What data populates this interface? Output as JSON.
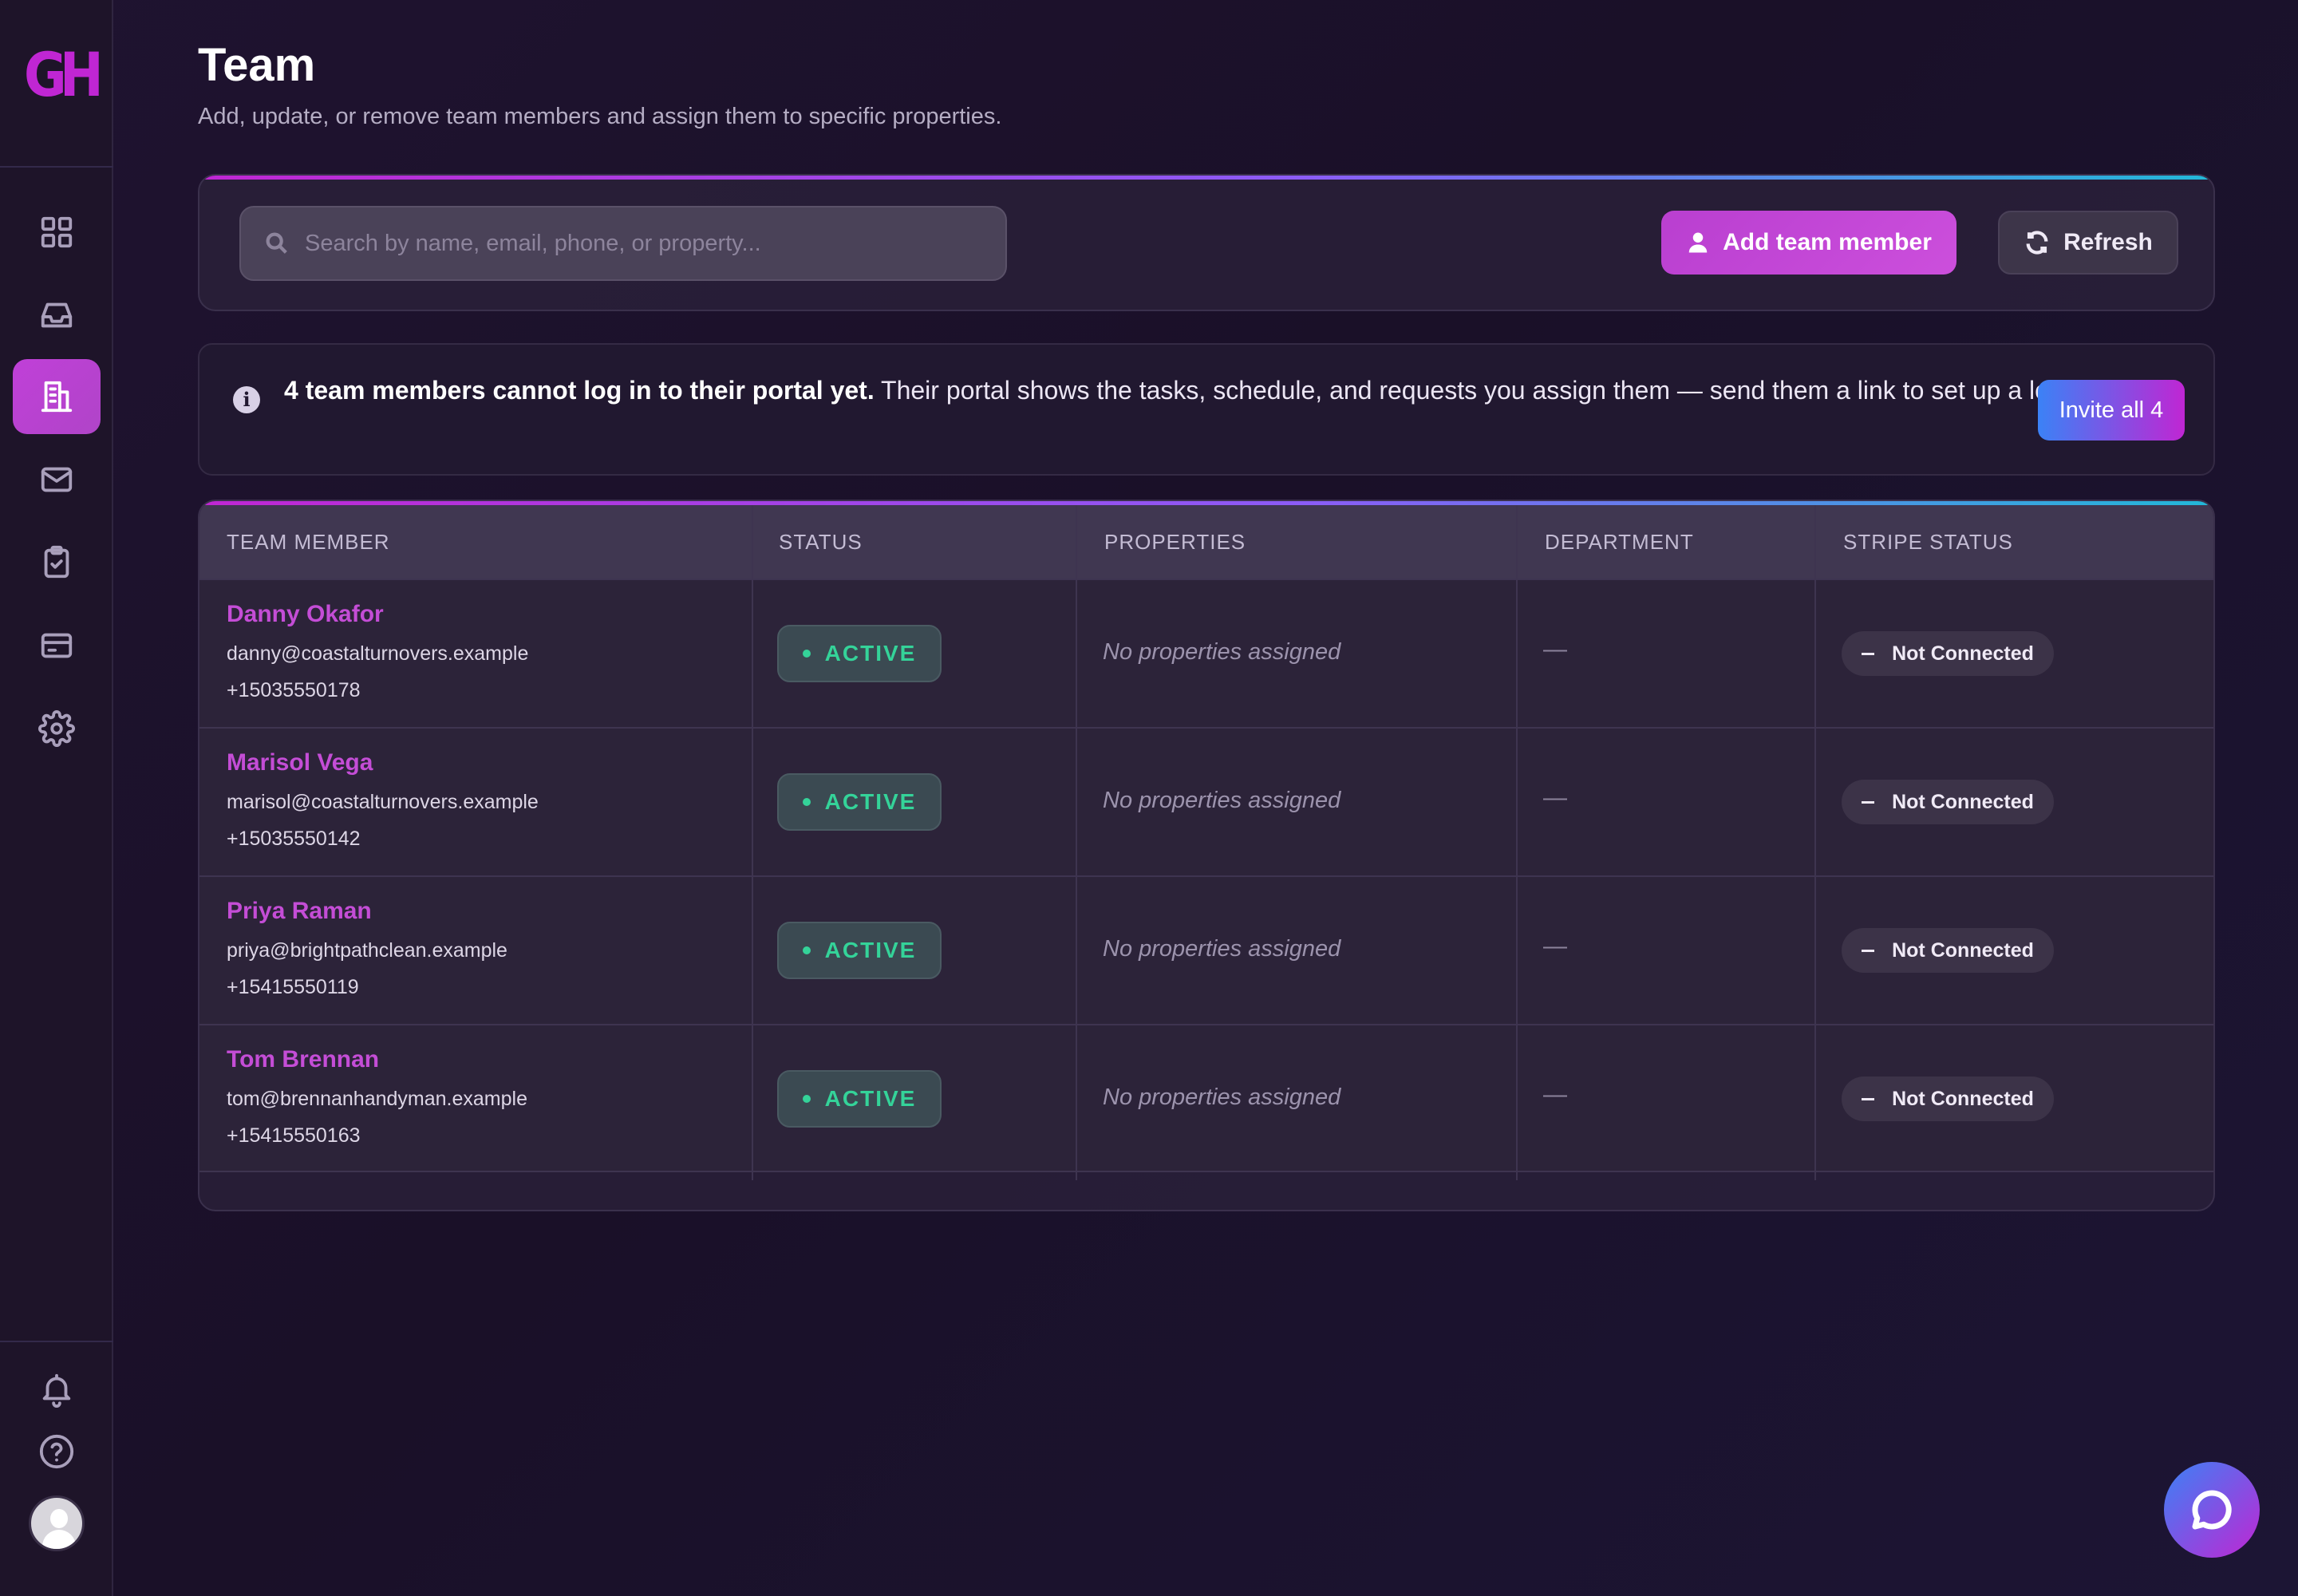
{
  "app": {
    "logo_text": "GH"
  },
  "sidebar": {
    "items": [
      {
        "icon": "grid-icon",
        "active": false
      },
      {
        "icon": "inbox-icon",
        "active": false
      },
      {
        "icon": "building-icon",
        "active": true
      },
      {
        "icon": "mail-icon",
        "active": false
      },
      {
        "icon": "clipboard-check-icon",
        "active": false
      },
      {
        "icon": "credit-card-icon",
        "active": false
      },
      {
        "icon": "gear-icon",
        "active": false
      }
    ],
    "bottom": [
      {
        "icon": "bell-icon"
      },
      {
        "icon": "help-icon"
      },
      {
        "icon": "avatar"
      }
    ]
  },
  "header": {
    "title": "Team",
    "subtitle": "Add, update, or remove team members and assign them to specific properties."
  },
  "toolbar": {
    "search_placeholder": "Search by name, email, phone, or property...",
    "search_value": "",
    "add_label": "Add team member",
    "refresh_label": "Refresh"
  },
  "notice": {
    "bold": "4 team members cannot log in to their portal yet.",
    "text": " Their portal shows the tasks, schedule, and requests you assign them — send them a link to set up a login.",
    "button": "Invite all 4"
  },
  "table": {
    "columns": [
      "TEAM MEMBER",
      "STATUS",
      "PROPERTIES",
      "DEPARTMENT",
      "STRIPE STATUS"
    ],
    "rows": [
      {
        "name": "Danny Okafor",
        "email": "danny@coastalturnovers.example",
        "phone": "+15035550178",
        "status": "ACTIVE",
        "properties": "No properties assigned",
        "department": "—",
        "stripe": "Not Connected"
      },
      {
        "name": "Marisol Vega",
        "email": "marisol@coastalturnovers.example",
        "phone": "+15035550142",
        "status": "ACTIVE",
        "properties": "No properties assigned",
        "department": "—",
        "stripe": "Not Connected"
      },
      {
        "name": "Priya Raman",
        "email": "priya@brightpathclean.example",
        "phone": "+15415550119",
        "status": "ACTIVE",
        "properties": "No properties assigned",
        "department": "—",
        "stripe": "Not Connected"
      },
      {
        "name": "Tom Brennan",
        "email": "tom@brennanhandyman.example",
        "phone": "+15415550163",
        "status": "ACTIVE",
        "properties": "No properties assigned",
        "department": "—",
        "stripe": "Not Connected"
      }
    ]
  },
  "colors": {
    "accent": "#c026d3",
    "active_status": "#34d399",
    "background": "#1f1330"
  }
}
